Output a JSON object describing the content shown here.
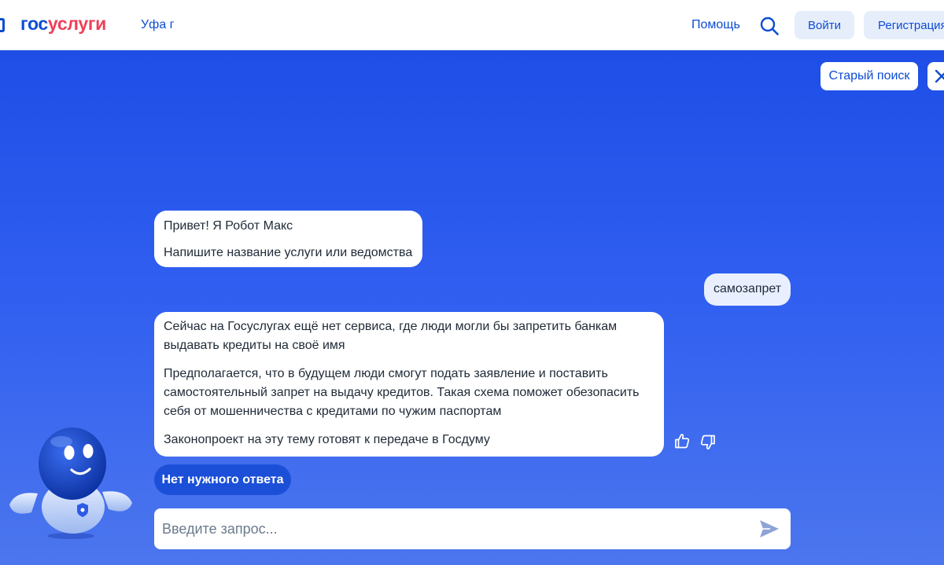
{
  "header": {
    "logo_part1": "гос",
    "logo_part2": "услуги",
    "city": "Уфа г",
    "help_label": "Помощь",
    "search_icon": "search-icon",
    "login_label": "Войти",
    "register_label": "Регистрация"
  },
  "chat": {
    "old_search_label": "Старый поиск",
    "close_icon": "close-icon",
    "messages": [
      {
        "from": "bot",
        "lines": [
          "Привет! Я Робот Макс",
          "Напишите название услуги или ведомства"
        ]
      },
      {
        "from": "user",
        "lines": [
          "самозапрет"
        ]
      },
      {
        "from": "bot",
        "lines": [
          "Сейчас на Госуслугах ещё нет сервиса, где люди могли бы запретить банкам выдавать кредиты на своё имя",
          "Предполагается, что в будущем люди смогут подать заявление и поставить самостоятельный запрет на выдачу кредитов. Такая схема поможет обезопасить себя от мошенничества с кредитами по чужим паспортам",
          "Законопроект на эту тему готовят к передаче в Госдуму"
        ]
      }
    ],
    "no_answer_label": "Нет нужного ответа",
    "input": {
      "value": "",
      "placeholder": "Введите запрос..."
    }
  },
  "colors": {
    "brand_blue": "#0d4cd3",
    "brand_red": "#ee3f58",
    "chat_bg_top": "#1e4ee6",
    "chat_bg_bottom": "#4c76ee"
  }
}
